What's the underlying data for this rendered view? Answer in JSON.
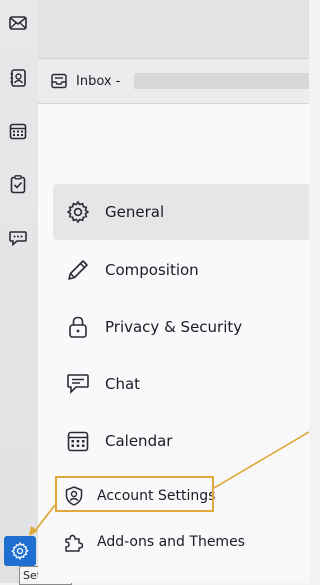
{
  "spaces": {
    "icons": [
      "mail-icon",
      "address-book-icon",
      "calendar-icon",
      "tasks-icon",
      "chat-icon"
    ],
    "settings_tooltip": "Settings"
  },
  "tab": {
    "label": "Inbox -"
  },
  "categories": [
    {
      "label": "General",
      "icon": "gear-icon"
    },
    {
      "label": "Composition",
      "icon": "pencil-icon"
    },
    {
      "label": "Privacy & Security",
      "icon": "lock-icon"
    },
    {
      "label": "Chat",
      "icon": "chat-icon"
    },
    {
      "label": "Calendar",
      "icon": "calendar-icon"
    }
  ],
  "bottom_links": [
    {
      "label": "Account Settings",
      "icon": "account-icon"
    },
    {
      "label": "Add-ons and Themes",
      "icon": "puzzle-icon"
    }
  ],
  "colors": {
    "settings_button": "#1f6fd0",
    "annotation": "#e0a93a"
  }
}
